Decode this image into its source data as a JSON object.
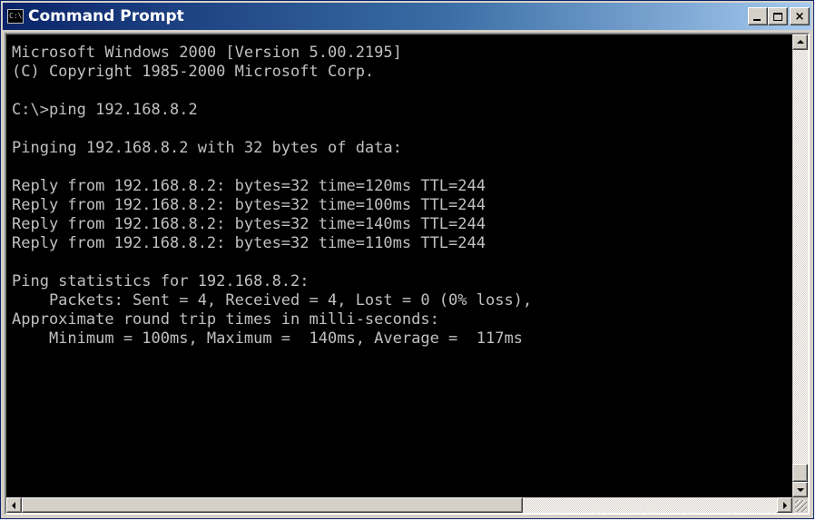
{
  "window": {
    "title": "Command Prompt",
    "icon_text": "C:\\",
    "buttons": {
      "minimize": "minimize-icon",
      "maximize": "maximize-icon",
      "close": "close-icon",
      "close_label": "×"
    }
  },
  "console": {
    "lines": [
      "Microsoft Windows 2000 [Version 5.00.2195]",
      "(C) Copyright 1985-2000 Microsoft Corp.",
      "",
      "C:\\>ping 192.168.8.2",
      "",
      "Pinging 192.168.8.2 with 32 bytes of data:",
      "",
      "Reply from 192.168.8.2: bytes=32 time=120ms TTL=244",
      "Reply from 192.168.8.2: bytes=32 time=100ms TTL=244",
      "Reply from 192.168.8.2: bytes=32 time=140ms TTL=244",
      "Reply from 192.168.8.2: bytes=32 time=110ms TTL=244",
      "",
      "Ping statistics for 192.168.8.2:",
      "    Packets: Sent = 4, Received = 4, Lost = 0 (0% loss),",
      "Approximate round trip times in milli-seconds:",
      "    Minimum = 100ms, Maximum =  140ms, Average =  117ms"
    ],
    "colors": {
      "background": "#000000",
      "text": "#c0c0c0"
    }
  }
}
